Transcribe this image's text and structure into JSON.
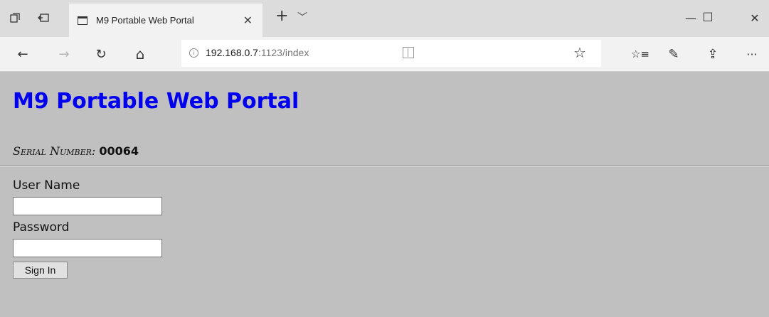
{
  "browser": {
    "tab": {
      "title": "M9 Portable Web Portal",
      "close_glyph": "✕"
    },
    "icons": {
      "tabs_aside": "tabs-aside-icon",
      "restore_tabs": "restore-tabs-icon",
      "favicon": "page-icon",
      "new_tab": "plus-icon",
      "tab_menu": "chevron-down-icon",
      "minimize": "minimize-icon",
      "maximize": "maximize-icon",
      "close": "close-icon",
      "back": "back-arrow-icon",
      "forward": "forward-arrow-icon",
      "refresh": "refresh-icon",
      "home": "home-icon",
      "info": "info-icon",
      "reading_view": "reading-view-icon",
      "favorite": "star-icon",
      "favorites_bar": "favorites-icon",
      "notes": "pen-icon",
      "share": "share-icon",
      "more": "more-icon"
    },
    "glyphs": {
      "new_tab": "+",
      "tab_menu": "﹀",
      "minimize": "—",
      "maximize": "☐",
      "close": "✕",
      "back": "←",
      "forward": "→",
      "refresh": "↻",
      "home": "⌂",
      "info": "i",
      "favorite": "☆",
      "favorites_bar": "☆≡",
      "notes": "✎",
      "share": "⇪",
      "more": "···"
    },
    "address": {
      "host": "192.168.0.7",
      "rest": ":1123/index"
    }
  },
  "page": {
    "title": "M9 Portable Web Portal",
    "serial_label": "Serial Number:",
    "serial_value": "00064",
    "username_label": "User Name",
    "username_value": "",
    "password_label": "Password",
    "password_value": "",
    "signin_label": "Sign In"
  },
  "colors": {
    "page_background": "#c0c0c0",
    "title": "#0000ee",
    "tabbar": "#dcdcdc",
    "toolbar": "#f2f2f2"
  }
}
